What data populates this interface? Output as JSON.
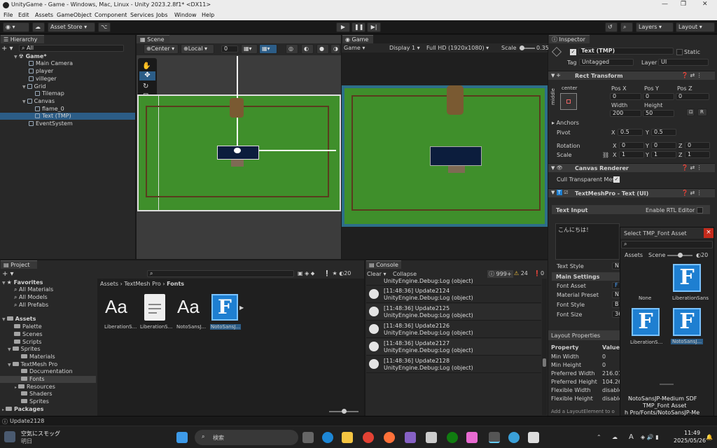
{
  "window": {
    "title": "UnityGame - Game - Windows, Mac, Linux - Unity 2023.2.8f1* <DX11>"
  },
  "menu": [
    "File",
    "Edit",
    "Assets",
    "GameObject",
    "Component",
    "Services",
    "Jobs",
    "Window",
    "Help"
  ],
  "toolbar": {
    "asset_store": "Asset Store",
    "layers": "Layers",
    "layout": "Layout"
  },
  "hierarchy": {
    "tab": "Hierarchy",
    "search": "All",
    "scene": "Game*",
    "items": [
      "Main Camera",
      "player",
      "villeger",
      "Grid",
      "Tilemap",
      "Canvas",
      "flame_0",
      "Text (TMP)",
      "EventSystem"
    ]
  },
  "scene": {
    "tab": "Scene",
    "pivot": "Center",
    "space": "Local",
    "zero": "0"
  },
  "game": {
    "tab": "Game",
    "mode": "Game",
    "display": "Display 1",
    "resolution": "Full HD (1920x1080)",
    "scale_label": "Scale",
    "scale_value": "0.35"
  },
  "inspector": {
    "tab": "Inspector",
    "object_name": "Text (TMP)",
    "static": "Static",
    "tag_label": "Tag",
    "tag": "Untagged",
    "layer_label": "Layer",
    "layer": "UI",
    "rect_transform": "Rect Transform",
    "anchor_h": "center",
    "anchor_v": "middle",
    "pos_x_label": "Pos X",
    "pos_y_label": "Pos Y",
    "pos_z_label": "Pos Z",
    "pos_x": "0",
    "pos_y": "0",
    "pos_z": "0",
    "width_label": "Width",
    "height_label": "Height",
    "width": "200",
    "height": "50",
    "r_btn": "R",
    "anchors": "Anchors",
    "pivot_label": "Pivot",
    "pivot_x": "0.5",
    "pivot_y": "0.5",
    "rotation_label": "Rotation",
    "rot_x": "0",
    "rot_y": "0",
    "rot_z": "0",
    "scale_label": "Scale",
    "scale_x": "1",
    "scale_y": "1",
    "scale_z": "1",
    "canvas_renderer": "Canvas Renderer",
    "cull": "Cull Transparent Mes",
    "tmp": "TextMeshPro - Text (UI)",
    "text_input": "Text Input",
    "rtl": "Enable RTL Editor",
    "text_value": "こんにちは！",
    "text_style": "Text Style",
    "text_style_val": "N",
    "main_settings": "Main Settings",
    "font_asset": "Font Asset",
    "font_asset_val": "F",
    "material_preset": "Material Preset",
    "material_preset_val": "N",
    "font_style": "Font Style",
    "font_style_val": "B",
    "font_size": "Font Size",
    "font_size_val": "36",
    "layout_props": "Layout Properties",
    "property": "Property",
    "value": "Value",
    "props": [
      {
        "k": "Min Width",
        "v": "0"
      },
      {
        "k": "Min Height",
        "v": "0"
      },
      {
        "k": "Preferred Width",
        "v": "216.01"
      },
      {
        "k": "Preferred Height",
        "v": "104.26"
      },
      {
        "k": "Flexible Width",
        "v": "disable"
      },
      {
        "k": "Flexible Height",
        "v": "disable"
      }
    ],
    "add_layout": "Add a LayoutElement to o"
  },
  "picker": {
    "title": "Select TMP_Font Asset",
    "close": "×",
    "tab_assets": "Assets",
    "tab_scene": "Scene",
    "count": "20",
    "items": [
      "None",
      "LiberationSans",
      "LiberationS...",
      "NotoSansJ..."
    ],
    "footer1": "NotoSansJP-Medium SDF",
    "footer2": "TMP_Font Asset",
    "footer3": "h Pro/Fonts/NotoSansJP-Me"
  },
  "project": {
    "tab": "Project",
    "favorites": "Favorites",
    "fav_items": [
      "All Materials",
      "All Models",
      "All Prefabs"
    ],
    "assets": "Assets",
    "tree": [
      "Palette",
      "Scenes",
      "Scripts",
      "Sprites",
      "Materials",
      "TextMesh Pro",
      "Documentation",
      "Fonts",
      "Resources",
      "Shaders",
      "Sprites"
    ],
    "packages": "Packages",
    "breadcrumb": [
      "Assets",
      "TextMesh Pro",
      "Fonts"
    ],
    "files": [
      "LiberationS...",
      "LiberationS...",
      "NotoSansJ...",
      "NotoSansJ..."
    ],
    "count": "20"
  },
  "console": {
    "tab": "Console",
    "clear": "Clear",
    "collapse": "Collapse",
    "logs_count": "999+",
    "warn_count": "24",
    "err_count": "0",
    "logs": [
      {
        "a": "UnityEngine.Debug:Log (object)",
        "b": ""
      },
      {
        "a": "[11:48:36] Update2124",
        "b": "UnityEngine.Debug:Log (object)"
      },
      {
        "a": "[11:48:36] Update2125",
        "b": "UnityEngine.Debug:Log (object)"
      },
      {
        "a": "[11:48:36] Update2126",
        "b": "UnityEngine.Debug:Log (object)"
      },
      {
        "a": "[11:48:36] Update2127",
        "b": "UnityEngine.Debug:Log (object)"
      },
      {
        "a": "[11:48:36] Update2128",
        "b": "UnityEngine.Debug:Log (object)"
      }
    ]
  },
  "status": {
    "text": "Update2128"
  },
  "taskbar": {
    "weather1": "空気にスモッグ",
    "weather2": "明日",
    "search": "検索",
    "time": "11:49",
    "date": "2025/05/26",
    "ime": "A"
  },
  "colors": {
    "accent": "#2c5d87",
    "grass": "#3f8f2b",
    "text_box": "#0c1d3d",
    "font_icon": "#1e7fd1"
  }
}
